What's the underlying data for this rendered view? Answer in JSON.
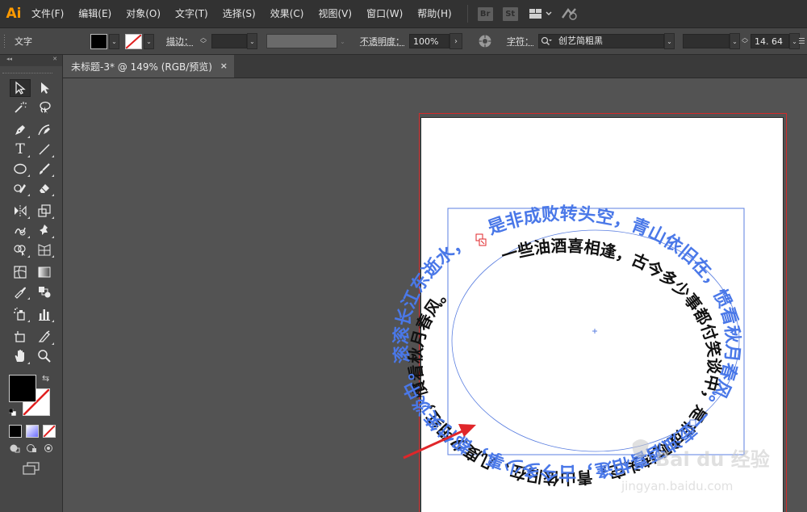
{
  "app": {
    "logo": "Ai",
    "menus": [
      "文件(F)",
      "编辑(E)",
      "对象(O)",
      "文字(T)",
      "选择(S)",
      "效果(C)",
      "视图(V)",
      "窗口(W)",
      "帮助(H)"
    ],
    "bridge_label": "Br",
    "stock_label": "St"
  },
  "control_bar": {
    "mode_label": "文字",
    "stroke_label": "描边：",
    "opacity_label": "不透明度：",
    "opacity_value": "100%",
    "character_label": "字符：",
    "font_name": "创艺简粗黑",
    "font_size": "14. 64"
  },
  "document_tab": {
    "title": "未标题-3* @ 149% (RGB/预览)",
    "close_label": "×"
  },
  "artwork": {
    "inner_path_text": "一些油酒喜相逢，古今多少事都付笑谈中，是非成败转头空，青山依旧在，几度夕阳红，慣看秋月春风。",
    "outer_path_text": "是非成败转头空，青山依旧在，惯看秋月春风。一壶浊酒喜相逢，古今多少事，都付笑谈中。滚滚长江东逝水，浪花淘尽英雄。",
    "watermark_main": "Bai du 经验",
    "watermark_sub": "jingyan.baidu.com"
  },
  "colors": {
    "menubar_bg": "#323232",
    "panel_bg": "#474747",
    "canvas_bg": "#535353",
    "selection_blue": "#5b7fe0",
    "artboard_border": "#d22a2a",
    "arrow_red": "#e0262a",
    "ai_orange": "#ff9a00"
  }
}
